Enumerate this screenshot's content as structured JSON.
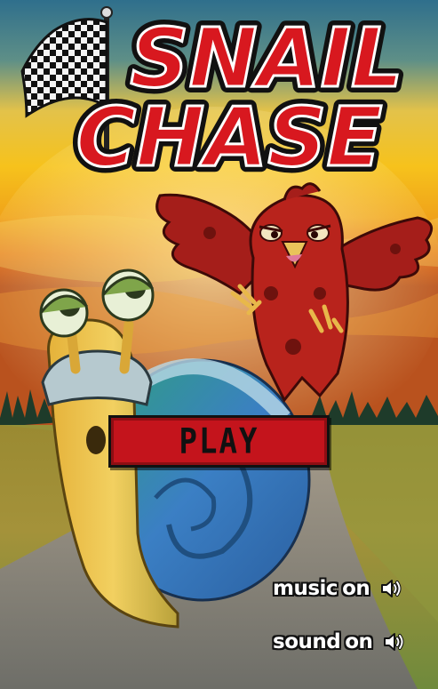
{
  "game": {
    "title_line1": "SNAIL",
    "title_line2": "CHASE"
  },
  "menu": {
    "play_label": "PLAY",
    "music_word": "music",
    "music_state": "on",
    "sound_word": "sound",
    "sound_state": "on"
  },
  "icons": {
    "music": "speaker-icon",
    "sound": "speaker-icon",
    "flag": "checkered-flag-icon"
  },
  "colors": {
    "title_red": "#d8181f",
    "button_red": "#c4141c",
    "sky_top": "#2f6f8c",
    "sky_glow": "#f6c21c",
    "horizon_orange": "#e26a16"
  }
}
